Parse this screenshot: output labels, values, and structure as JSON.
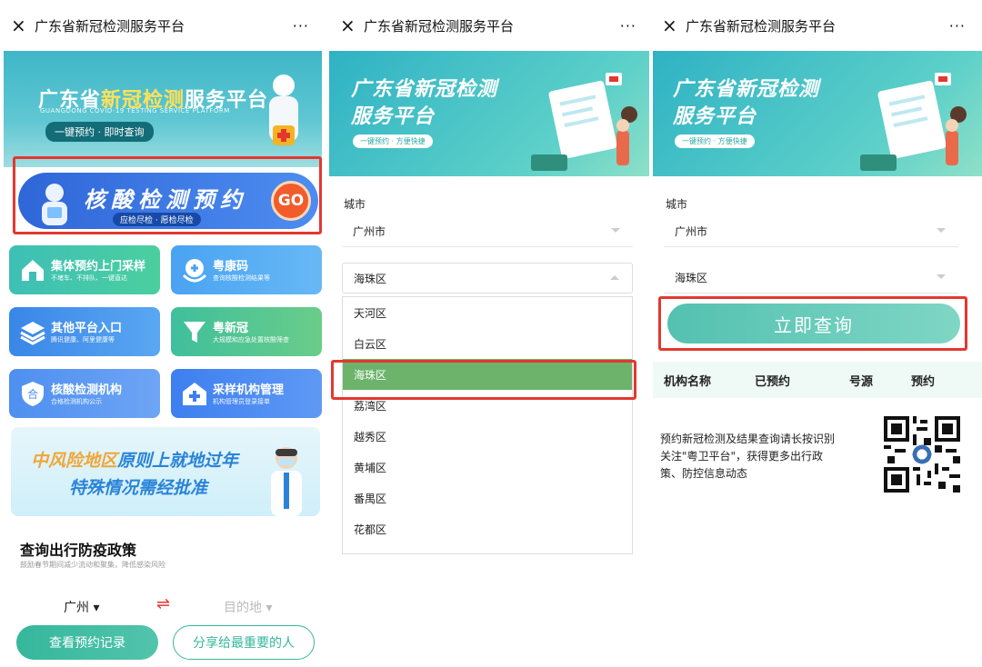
{
  "app_title": "广东省新冠检测服务平台",
  "more_icon": "···",
  "close_icon": "×",
  "panel1": {
    "hero_title_a": "广东省",
    "hero_title_b": "新冠检测",
    "hero_title_c": "服务平台",
    "hero_subtitle": "GUANGDONG COVID-19 TESTING SERVICE PLATFORM",
    "hero_pill": "一键预约 · 即时查询",
    "appoint_title": "核酸检测预约",
    "appoint_sub": "应检尽检 · 愿检尽检",
    "appoint_go": "GO",
    "tiles": [
      {
        "title": "集体预约上门采样",
        "sub": "不堵车、不排队、一键直达"
      },
      {
        "title": "粤康码",
        "sub": "查询核酸检测结果等"
      },
      {
        "title": "其他平台入口",
        "sub": "腾讯健康、阿里健康等"
      },
      {
        "title": "粤新冠",
        "sub": "大规模和应急处置核酸筛查"
      },
      {
        "title": "核酸检测机构",
        "sub": "合格检测机构公示"
      },
      {
        "title": "采样机构管理",
        "sub": "机构管理员登录接单"
      }
    ],
    "banner_line1_a": "中风险地区",
    "banner_line1_b": "原则上就地过年",
    "banner_line2": "特殊情况需经批准",
    "policy_title": "查询出行防疫政策",
    "policy_sub": "鼓励春节期间减少流动和聚集，降低感染风险",
    "from_city": "广州 ▾",
    "swap_icon": "⇌",
    "dest_placeholder": "目的地 ▾",
    "btn_records": "查看预约记录",
    "btn_share": "分享给最重要的人"
  },
  "hero2": {
    "title_line1": "广东省新冠检测",
    "title_line2": "服务平台",
    "tag": "一键预约 · 方便快捷"
  },
  "panel2": {
    "city_label": "城市",
    "city_value": "广州市",
    "district_value": "海珠区",
    "options": [
      "天河区",
      "白云区",
      "海珠区",
      "荔湾区",
      "越秀区",
      "黄埔区",
      "番禺区",
      "花都区"
    ],
    "selected_index": 2
  },
  "panel3": {
    "city_label": "城市",
    "city_value": "广州市",
    "district_value": "海珠区",
    "query_button": "立即查询",
    "columns": [
      "机构名称",
      "已预约",
      "号源",
      "预约"
    ],
    "footer_text_1": "预约新冠检测及结果查询请长按识别",
    "footer_text_2": "关注\"粤卫平台\"，获得更多出行政",
    "footer_text_3": "策、防控信息动态"
  },
  "colors": {
    "accent_green": "#35b79b",
    "highlight_red": "#e3382f",
    "selected_option": "#6db36c"
  }
}
